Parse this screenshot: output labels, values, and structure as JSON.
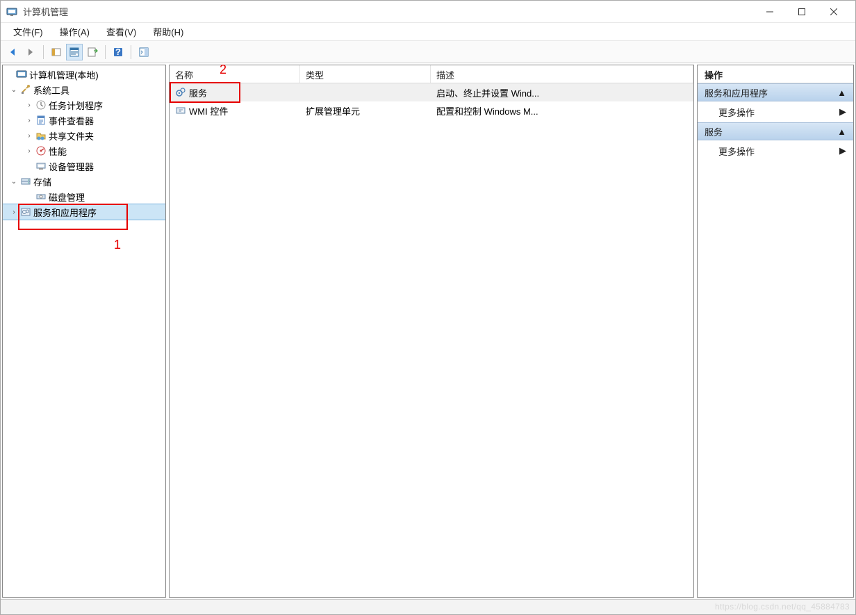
{
  "window": {
    "title": "计算机管理"
  },
  "menu": {
    "file": "文件(F)",
    "action": "操作(A)",
    "view": "查看(V)",
    "help": "帮助(H)"
  },
  "tree": {
    "root": "计算机管理(本地)",
    "systemTools": "系统工具",
    "taskScheduler": "任务计划程序",
    "eventViewer": "事件查看器",
    "sharedFolders": "共享文件夹",
    "performance": "性能",
    "deviceManager": "设备管理器",
    "storage": "存储",
    "diskManagement": "磁盘管理",
    "servicesApps": "服务和应用程序"
  },
  "list": {
    "columns": {
      "name": "名称",
      "type": "类型",
      "desc": "描述"
    },
    "rows": [
      {
        "name": "服务",
        "type": "",
        "desc": "启动、终止并设置 Wind...",
        "selected": true,
        "icon": "gears"
      },
      {
        "name": "WMI 控件",
        "type": "扩展管理单元",
        "desc": "配置和控制 Windows M...",
        "selected": false,
        "icon": "wmi"
      }
    ]
  },
  "actions": {
    "header": "操作",
    "group1": "服务和应用程序",
    "more1": "更多操作",
    "group2": "服务",
    "more2": "更多操作"
  },
  "annotations": {
    "label1": "1",
    "label2": "2"
  },
  "watermark": "https://blog.csdn.net/qq_45884783"
}
